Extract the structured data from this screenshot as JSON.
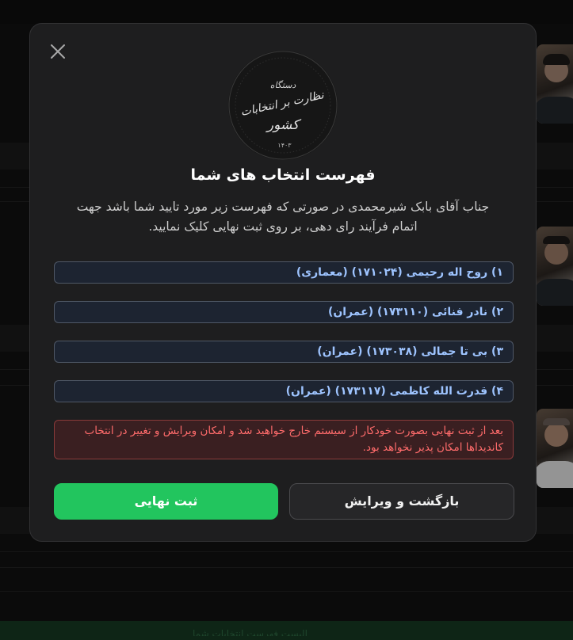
{
  "modal": {
    "title": "فهرست انتخاب های شما",
    "description": "جناب آقای بابک شیرمحمدی در صورتی که فهرست زیر مورد تایید شما باشد جهت اتمام فرآیند رای دهی، بر روی ثبت نهایی کلیک نمایید.",
    "seal": {
      "line1": "دستگاه",
      "line2": "نظارت بر انتخابات",
      "line3": "کشور",
      "year": "۱۴۰۳"
    },
    "candidates": [
      "۱) روح اله رحیمی (۱۷۱۰۲۴) (معماری)",
      "۲) نادر فنائی (۱۷۳۱۱۰) (عمران)",
      "۳) بی تا جمالی (۱۷۳۰۳۸) (عمران)",
      "۴) قدرت الله کاظمی (۱۷۳۱۱۷) (عمران)"
    ],
    "warning": "بعد از ثبت نهایی بصورت خودکار از سیستم خارج خواهید شد و امکان ویرایش و تغییر در انتخاب کاندیداها امکان پذیر نخواهد بود.",
    "confirm_label": "ثبت نهایی",
    "back_label": "بازگشت و ویرایش"
  },
  "background": {
    "footer_text": "الیست فهرست انتخابات شما"
  },
  "colors": {
    "confirm": "#22c55e",
    "candidate_text": "#9ec4ff",
    "warning_text": "#ff6b6b"
  },
  "icons": {
    "close": "close-icon",
    "seal": "seal-emblem"
  }
}
